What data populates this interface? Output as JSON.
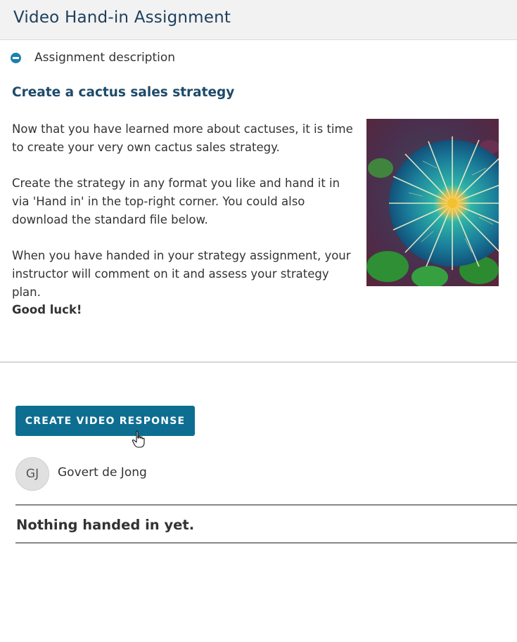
{
  "header": {
    "title": "Video Hand-in Assignment"
  },
  "description_toggle": {
    "label": "Assignment description",
    "icon": "minus-circle-icon"
  },
  "assignment": {
    "title": "Create a cactus sales strategy",
    "paragraphs": [
      "Now that you have learned more about cactuses, it is time to create your very own cactus sales strategy.",
      "Create the strategy in any format you like and hand it in via 'Hand in' in the top-right corner. You could also download the standard file below.",
      "When you have handed in your strategy assignment, your instructor will comment on it and assess your strategy plan.",
      "Good luck!"
    ]
  },
  "actions": {
    "create_video_label": "CREATE VIDEO RESPONSE"
  },
  "user": {
    "initials": "GJ",
    "name": "Govert de Jong"
  },
  "submission": {
    "empty_text": "Nothing handed in yet."
  },
  "colors": {
    "accent": "#0d6e91",
    "title": "#1e4a6a",
    "icon": "#1d7fae"
  }
}
